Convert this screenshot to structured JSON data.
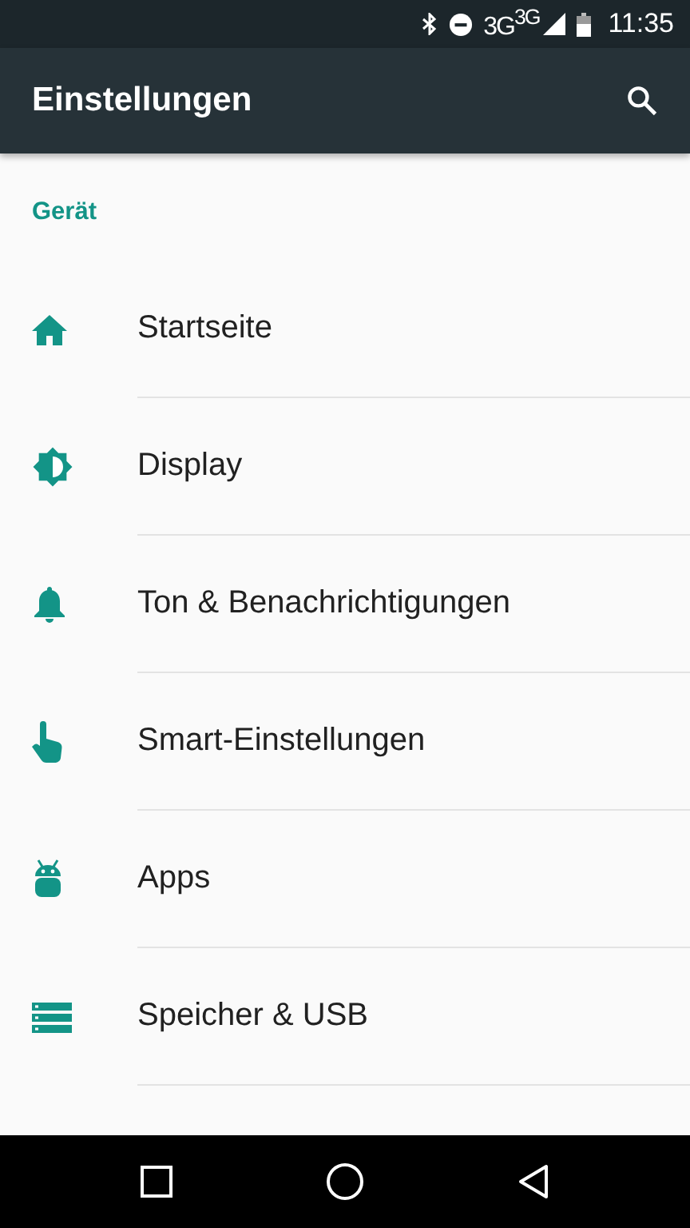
{
  "status_bar": {
    "network": "3G$^{3G}$",
    "time": "11:35"
  },
  "app_bar": {
    "title": "Einstellungen"
  },
  "section": {
    "title": "Gerät"
  },
  "items": [
    {
      "kind": "home",
      "label": "Startseite"
    },
    {
      "kind": "display",
      "label": "Display"
    },
    {
      "kind": "bell",
      "label": "Ton & Benachrichtigungen"
    },
    {
      "kind": "hand",
      "label": "Smart-Einstellungen"
    },
    {
      "kind": "android",
      "label": "Apps"
    },
    {
      "kind": "storage",
      "label": "Speicher & USB"
    }
  ]
}
